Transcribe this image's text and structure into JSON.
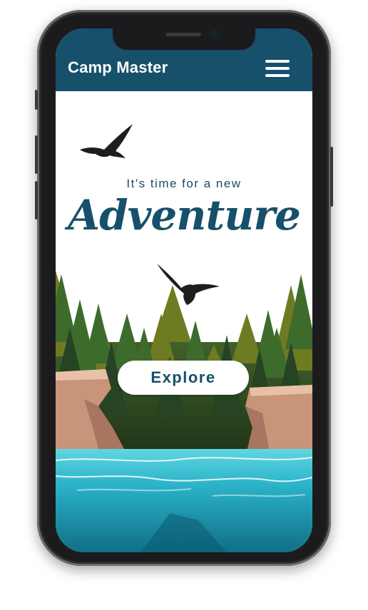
{
  "header": {
    "title": "Camp Master",
    "menu_icon": "hamburger-menu-icon",
    "background_color": "#16506a"
  },
  "hero": {
    "tagline": "It's time for a new",
    "headline": "Adventure",
    "explore_label": "Explore",
    "text_color": "#16506a"
  },
  "illustration": {
    "elements": [
      "eagle-icon",
      "forest",
      "cliffs",
      "water"
    ],
    "water_color": "#2bb3c9",
    "forest_color": "#2f4a1e"
  }
}
